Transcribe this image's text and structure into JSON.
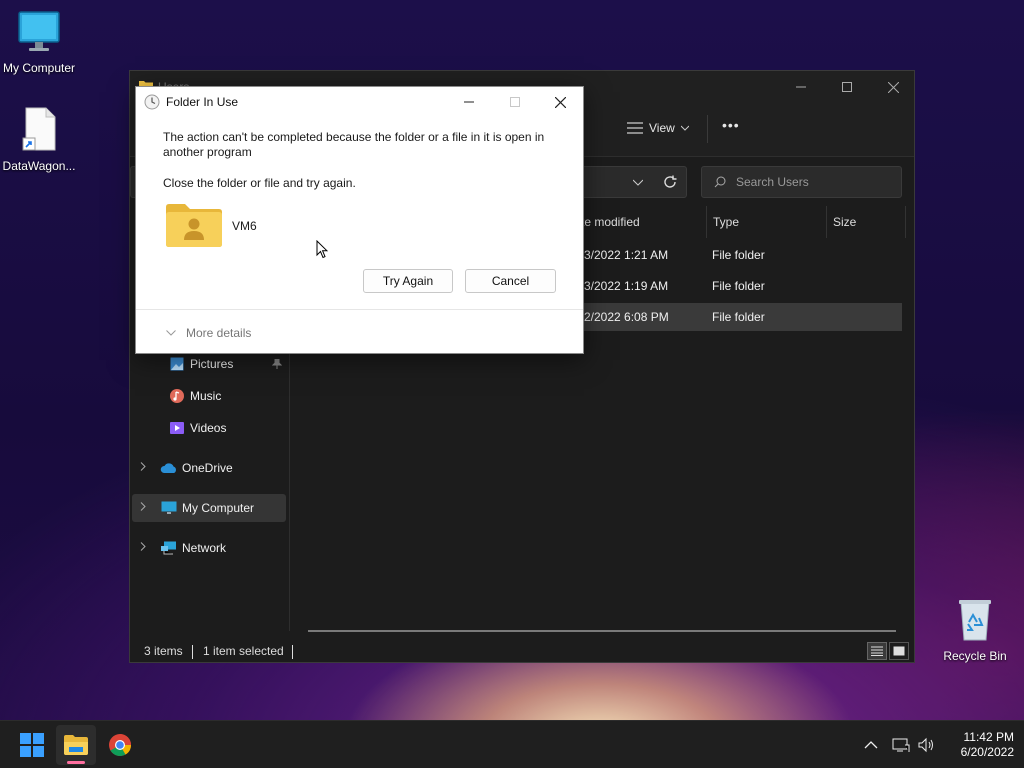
{
  "desktop": {
    "icons": [
      {
        "label": "My Computer"
      },
      {
        "label": "DataWagon..."
      },
      {
        "label": "Recycle Bin"
      }
    ]
  },
  "explorer": {
    "title": "Users",
    "toolbar": {
      "view_label": "View",
      "more_glyph": "•••"
    },
    "search_placeholder": "Search Users",
    "columns": [
      "te modified",
      "Type",
      "Size"
    ],
    "rows": [
      {
        "date": "3/2022 1:21 AM",
        "type": "File folder",
        "selected": false
      },
      {
        "date": "3/2022 1:19 AM",
        "type": "File folder",
        "selected": false
      },
      {
        "date": "2/2022 6:08 PM",
        "type": "File folder",
        "selected": true
      }
    ],
    "nav": [
      {
        "label": "Pictures",
        "icon": "pictures-icon",
        "pinned": true
      },
      {
        "label": "Music",
        "icon": "music-icon"
      },
      {
        "label": "Videos",
        "icon": "videos-icon"
      },
      {
        "label": "OneDrive",
        "icon": "onedrive-icon"
      },
      {
        "label": "My Computer",
        "icon": "computer-icon",
        "selected": true
      },
      {
        "label": "Network",
        "icon": "network-icon"
      }
    ],
    "status": {
      "items": "3 items",
      "selected": "1 item selected"
    }
  },
  "dialog": {
    "title": "Folder In Use",
    "message": "The action can't be completed because the folder or a file in it is open in another program",
    "instruction": "Close the folder or file and try again.",
    "item_name": "VM6",
    "try_again_label": "Try Again",
    "cancel_label": "Cancel",
    "more_details_label": "More details"
  },
  "taskbar": {
    "time": "11:42 PM",
    "date": "6/20/2022"
  },
  "colors": {
    "accent": "#0078d4",
    "folder": "#f4c542",
    "selection": "#3a3a3a"
  }
}
